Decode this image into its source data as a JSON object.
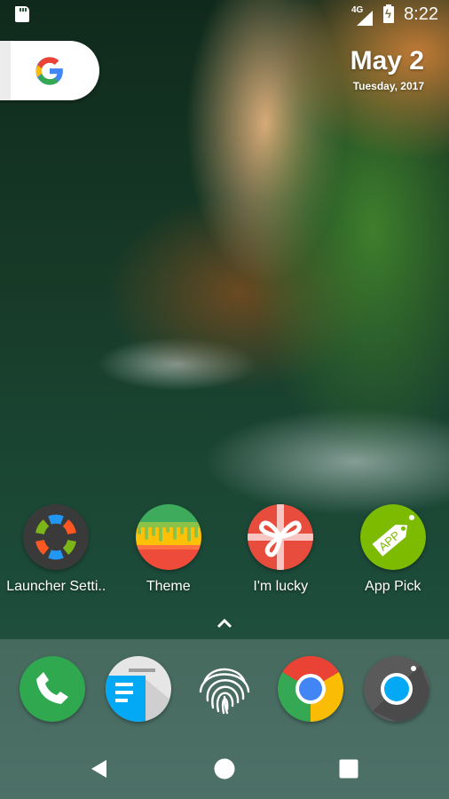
{
  "status_bar": {
    "left_icons": [
      "sd-card-icon"
    ],
    "network_label": "4G",
    "network_icon": "signal-no-data-icon",
    "battery_icon": "battery-charging-icon",
    "time": "8:22"
  },
  "search_widget": {
    "icon": "google-g-icon"
  },
  "date_widget": {
    "date": "May 2",
    "subtitle": "Tuesday, 2017"
  },
  "home_apps": [
    {
      "label": "Launcher Setti..",
      "icon": "launcher-settings-icon"
    },
    {
      "label": "Theme",
      "icon": "theme-icon"
    },
    {
      "label": "I'm lucky",
      "icon": "gift-icon"
    },
    {
      "label": "App Pick",
      "icon": "app-tag-icon"
    }
  ],
  "app_drawer_handle": {
    "icon": "chevron-up-icon"
  },
  "dock": [
    {
      "name": "Phone",
      "icon": "phone-icon"
    },
    {
      "name": "Messages",
      "icon": "messages-icon"
    },
    {
      "name": "Fingerprint",
      "icon": "fingerprint-icon"
    },
    {
      "name": "Chrome",
      "icon": "chrome-icon"
    },
    {
      "name": "Camera",
      "icon": "camera-icon"
    }
  ],
  "nav_bar": {
    "back": "back-icon",
    "home": "home-icon",
    "recents": "recents-icon"
  },
  "colors": {
    "google_blue": "#4285F4",
    "google_red": "#EA4335",
    "google_yellow": "#FBBC05",
    "google_green": "#34A853",
    "launcher_dark": "#3a3a3a",
    "lucky_red": "#E84C3D",
    "app_pick_green": "#7CBB00",
    "phone_green": "#2FA84F",
    "camera_blue": "#03A9F4"
  }
}
